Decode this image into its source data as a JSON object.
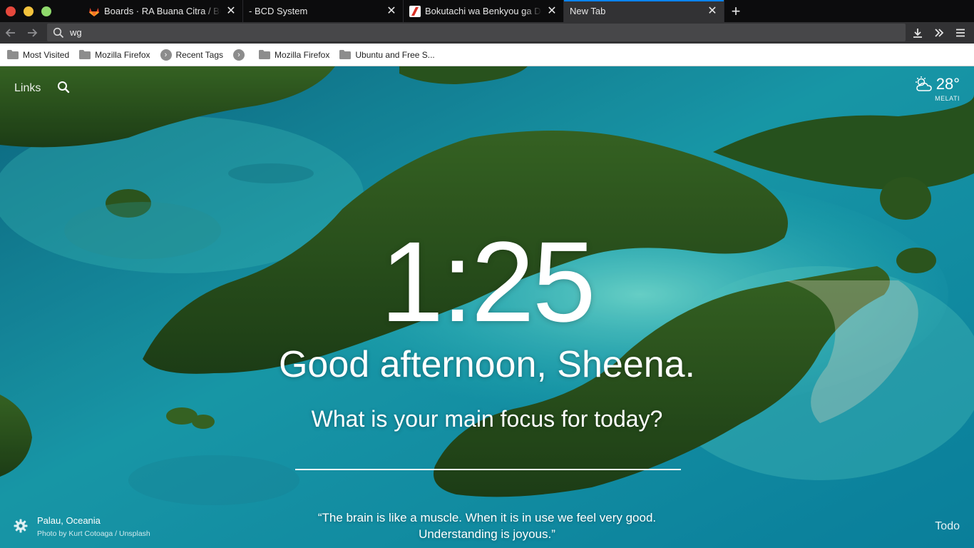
{
  "browser": {
    "tabs": [
      {
        "title": "Boards · RA Buana Citra / BCD",
        "icon": "gitlab-icon"
      },
      {
        "title": "- BCD System",
        "icon": "none"
      },
      {
        "title": "Bokutachi wa Benkyou ga Dekinai",
        "icon": "site-icon"
      },
      {
        "title": "New Tab",
        "icon": "none",
        "active": true
      }
    ],
    "address": {
      "value": "wg"
    },
    "bookmarks": [
      {
        "label": "Most Visited",
        "icon": "folder-icon"
      },
      {
        "label": "Mozilla Firefox",
        "icon": "folder-icon"
      },
      {
        "label": "Recent Tags",
        "icon": "chevron-right-icon"
      },
      {
        "label": "",
        "icon": "chevron-right-icon"
      },
      {
        "label": "Mozilla Firefox",
        "icon": "folder-icon"
      },
      {
        "label": "Ubuntu and Free S...",
        "icon": "folder-icon"
      }
    ]
  },
  "momentum": {
    "links_label": "Links",
    "weather": {
      "temp": "28°",
      "location": "MELATI",
      "icon": "partly-cloudy-icon"
    },
    "time": "1:25",
    "greeting": "Good afternoon, Sheena.",
    "focus_question": "What is your main focus for today?",
    "focus_value": "",
    "photo_location": "Palau, Oceania",
    "photo_credit": "Photo by Kurt Cotoaga / Unsplash",
    "quote": "“The brain is like a muscle. When it is in use we feel very good. Understanding is joyous.”",
    "todo_label": "Todo"
  },
  "colors": {
    "accent": "#0a84ff",
    "tab_bg": "#0c0c0d",
    "toolbar": "#323234"
  }
}
